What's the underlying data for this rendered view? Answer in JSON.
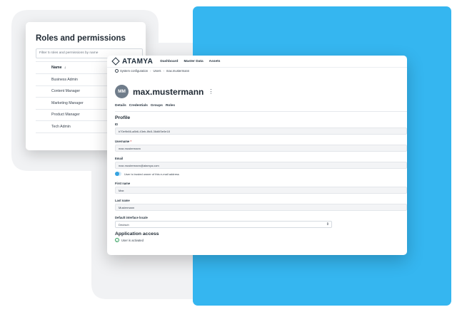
{
  "colors": {
    "accent_blue": "#35b6f0",
    "avatar_gray": "#6f7c8a",
    "toggle_blue": "#35a3e0",
    "success_green": "#2f9e5b"
  },
  "roles_panel": {
    "title": "Roles and permissions",
    "filter_placeholder": "Filter 5 roles and permissions by name",
    "column_header": "Name",
    "sort_icon": "sort-down-arrow",
    "rows": [
      "Business Admin",
      "Content Manager",
      "Marketing Manager",
      "Product Manager",
      "Tech Admin"
    ]
  },
  "app": {
    "logo_text": "ATAMYA",
    "logo_icon": "diamond-logo",
    "nav": [
      "Dashboard",
      "Master Data",
      "Assets"
    ]
  },
  "breadcrumb": {
    "home_icon": "home-icon",
    "items": [
      "System configuration",
      "Users",
      "max.mustermann"
    ]
  },
  "user": {
    "initials": "MM",
    "username_display": "max.mustermann",
    "menu_icon": "kebab-menu-icon"
  },
  "tabs": [
    "Details",
    "Credentials",
    "Groups",
    "Roles"
  ],
  "profile": {
    "title": "Profile",
    "id_label": "ID",
    "id_value": "b70e9b66-a8b6-43eb-8fc5-36d6f3e0e18",
    "username_label": "Username",
    "username_required": "*",
    "username_value": "max.mustermann",
    "email_label": "Email",
    "email_value": "max.mustermann@atamya.com",
    "email_toggle_label": "User is trusted owner of this e-mail address",
    "firstname_label": "First name",
    "firstname_value": "Max",
    "lastname_label": "Last name",
    "lastname_value": "Mustermann",
    "locale_label": "Default interface locale",
    "locale_value": "Deutsch"
  },
  "access": {
    "title": "Application access",
    "status": "User is activated"
  }
}
